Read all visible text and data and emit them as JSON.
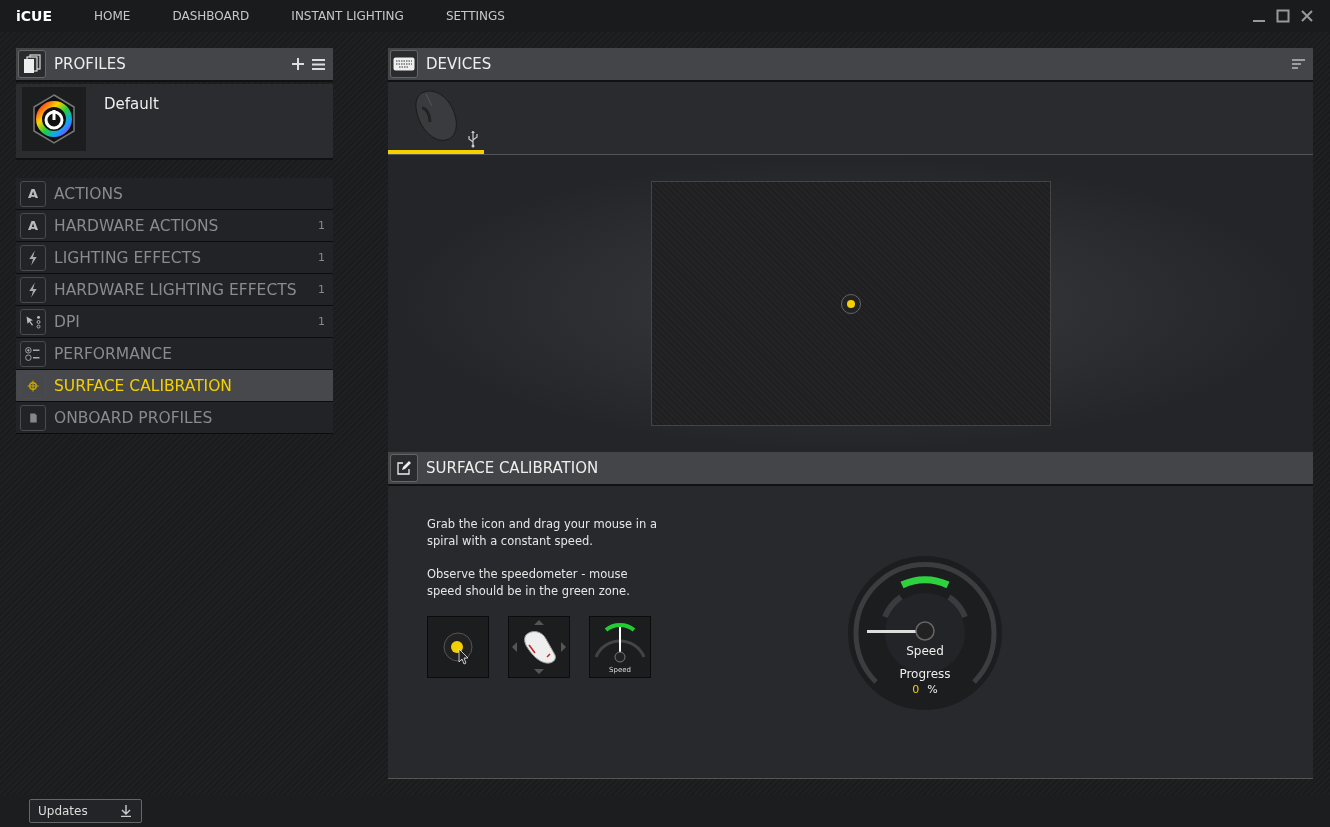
{
  "app": {
    "logo": "iCUE",
    "nav": [
      {
        "label": "HOME",
        "selected": false
      },
      {
        "label": "DASHBOARD",
        "selected": false
      },
      {
        "label": "INSTANT LIGHTING",
        "selected": false
      },
      {
        "label": "SETTINGS",
        "selected": false
      }
    ]
  },
  "profiles": {
    "title": "PROFILES",
    "profile": {
      "name": "Default"
    },
    "items": [
      {
        "kind": "letter",
        "glyph": "A",
        "label": "ACTIONS",
        "selected": false
      },
      {
        "kind": "letter",
        "glyph": "A",
        "label": "HARDWARE ACTIONS",
        "count": "1",
        "selected": false
      },
      {
        "kind": "bolt",
        "label": "LIGHTING EFFECTS",
        "count": "1",
        "selected": false
      },
      {
        "kind": "bolt",
        "label": "HARDWARE LIGHTING EFFECTS",
        "count": "1",
        "selected": false
      },
      {
        "kind": "dpi",
        "label": "DPI",
        "count": "1",
        "selected": false
      },
      {
        "kind": "performance",
        "label": "PERFORMANCE",
        "selected": false
      },
      {
        "kind": "target",
        "label": "SURFACE CALIBRATION",
        "selected": true
      },
      {
        "kind": "card",
        "label": "ONBOARD PROFILES",
        "selected": false
      }
    ]
  },
  "devices": {
    "title": "DEVICES",
    "tabs": [
      {
        "selected": true
      }
    ]
  },
  "calibration": {
    "title": "SURFACE CALIBRATION",
    "instructions": [
      "Grab the icon and drag your mouse in a spiral with a constant speed.",
      "Observe the speedometer - mouse speed should be in the green zone."
    ],
    "mini_gauge_label": "Speed",
    "gauge": {
      "speed_label": "Speed",
      "progress_label": "Progress",
      "progress_value": "0",
      "progress_unit": "%"
    }
  },
  "footer": {
    "updates_button": "Updates"
  }
}
